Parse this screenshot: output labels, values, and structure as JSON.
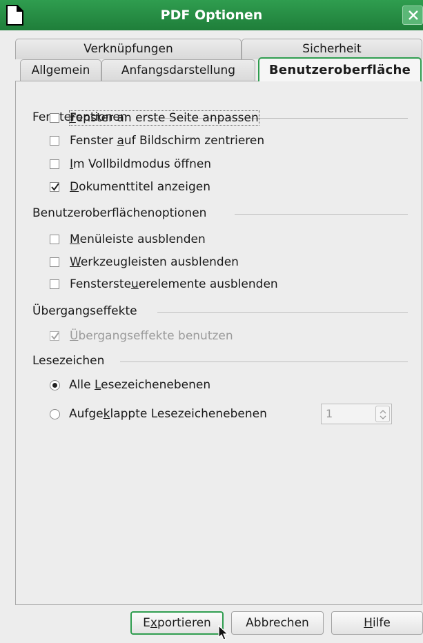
{
  "window": {
    "title": "PDF Optionen",
    "icons": {
      "app": "document-icon",
      "close": "close-icon"
    }
  },
  "tabs": {
    "row1": [
      "Verknüpfungen",
      "Sicherheit"
    ],
    "row2": [
      "Allgemein",
      "Anfangsdarstellung",
      "Benutzeroberfläche"
    ],
    "active": "Benutzeroberfläche"
  },
  "groups": {
    "window_options": {
      "title": "Fensteroptionen",
      "items": [
        {
          "pre": "",
          "mn": "F",
          "post": "enster an erste Seite anpassen",
          "checked": false
        },
        {
          "pre": "Fenster ",
          "mn": "a",
          "post": "uf Bildschirm zentrieren",
          "checked": false
        },
        {
          "pre": "",
          "mn": "I",
          "post": "m Vollbildmodus öffnen",
          "checked": false
        },
        {
          "pre": "",
          "mn": "D",
          "post": "okumenttitel anzeigen",
          "checked": true
        }
      ]
    },
    "ui_options": {
      "title": "Benutzeroberflächenoptionen",
      "items": [
        {
          "pre": "",
          "mn": "M",
          "post": "enüleiste ausblenden",
          "checked": false
        },
        {
          "pre": "",
          "mn": "W",
          "post": "erkzeugleisten ausblenden",
          "checked": false
        },
        {
          "pre": "Fensterste",
          "mn": "u",
          "post": "erelemente ausblenden",
          "checked": false
        }
      ]
    },
    "transitions": {
      "title": "Übergangseffekte",
      "items": [
        {
          "pre": "",
          "mn": "Ü",
          "post": "bergangseffekte benutzen",
          "checked": true,
          "disabled": true
        }
      ]
    },
    "bookmarks": {
      "title": "Lesezeichen",
      "radio_all": {
        "pre": "Alle ",
        "mn": "L",
        "post": "esezeichenebenen",
        "selected": true
      },
      "radio_levels": {
        "pre": "Aufge",
        "mn": "k",
        "post": "lappte Lesezeichenebenen",
        "selected": false
      },
      "levels_value": "1"
    }
  },
  "buttons": {
    "export": {
      "pre": "E",
      "mn": "x",
      "post": "portieren"
    },
    "cancel": {
      "pre": "",
      "mn": "",
      "post": "Abbrechen"
    },
    "help": {
      "pre": "",
      "mn": "H",
      "post": "ilfe"
    }
  },
  "colors": {
    "titlebar": "#2f9d4f",
    "background": "#ededed",
    "focus": "#2f9d4f"
  }
}
